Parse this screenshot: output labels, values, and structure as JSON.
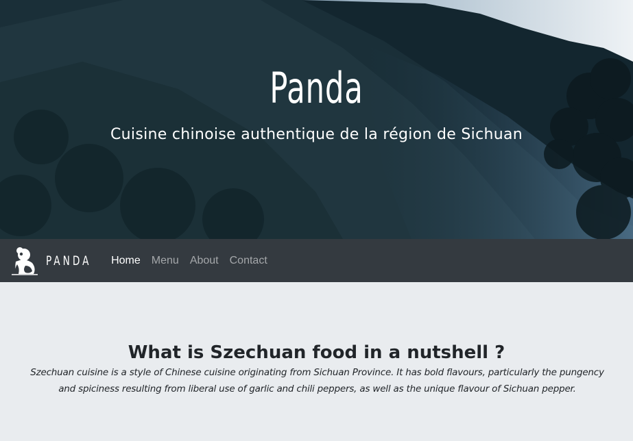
{
  "hero": {
    "title": "Panda",
    "subtitle": "Cuisine chinoise authentique de la région de Sichuan"
  },
  "navbar": {
    "brand": "PANDA",
    "logo_icon": "panda-icon",
    "links": [
      {
        "label": "Home",
        "active": true
      },
      {
        "label": "Menu",
        "active": false
      },
      {
        "label": "About",
        "active": false
      },
      {
        "label": "Contact",
        "active": false
      }
    ]
  },
  "main": {
    "heading": "What is Szechuan food in a nutshell ?",
    "paragraph": "Szechuan cuisine is a style of Chinese cuisine originating from Sichuan Province. It has bold flavours, particularly the pungency and spiciness resulting from liberal use of garlic and chili peppers, as well as the unique flavour of Sichuan pepper."
  },
  "colors": {
    "navbar_bg": "#343a40",
    "content_bg": "#e9ecef",
    "text": "#212529"
  }
}
